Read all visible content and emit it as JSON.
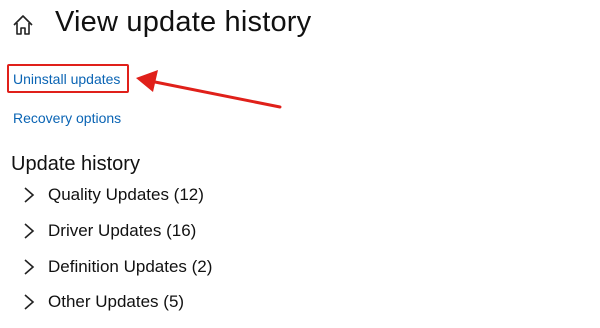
{
  "header": {
    "title": "View update history",
    "home_icon": "home-icon"
  },
  "links": {
    "uninstall": "Uninstall updates",
    "recovery": "Recovery options"
  },
  "section": {
    "title": "Update history"
  },
  "categories": [
    {
      "label": "Quality Updates (12)"
    },
    {
      "label": "Driver Updates (16)"
    },
    {
      "label": "Definition Updates (2)"
    },
    {
      "label": "Other Updates (5)"
    }
  ],
  "colors": {
    "link": "#0a64b4",
    "annotation": "#e0201a"
  }
}
